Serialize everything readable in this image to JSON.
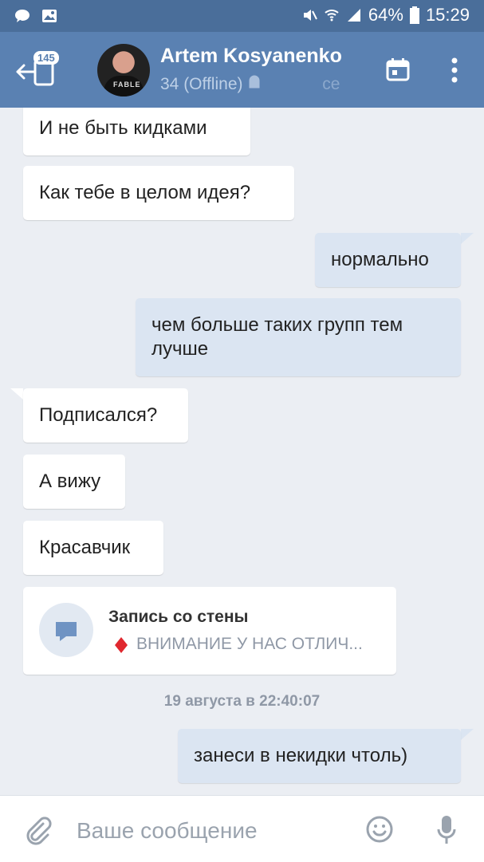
{
  "status_bar": {
    "battery": "64%",
    "time": "15:29"
  },
  "header": {
    "unread_badge": "145",
    "contact_name": "Artem Kosyanenko",
    "status": "34 (Offline)",
    "status_suffix": "се",
    "avatar_shirt_text": "FABLE"
  },
  "messages": [
    {
      "text": "И не быть кидками"
    },
    {
      "text": "Как тебе в целом идея?"
    },
    {
      "text": "нормально"
    },
    {
      "text_line1": "чем больше таких групп тем",
      "text_line2": "лучше"
    },
    {
      "text": "Подписался?"
    },
    {
      "text": "А вижу"
    },
    {
      "text": "Красавчик"
    },
    {
      "text": "занеси в некидки чтоль)"
    }
  ],
  "wall_post": {
    "title": "Запись со стены",
    "preview": "ВНИМАНИЕ У НАС ОТЛИЧ..."
  },
  "date_separator": "19 августа в 22:40:07",
  "composer": {
    "placeholder": "Ваше сообщение"
  },
  "colors": {
    "header": "#5a81b2",
    "status_bar": "#4a6e9a",
    "background": "#ebeef3",
    "outgoing_bubble": "#dbe5f2",
    "incoming_bubble": "#ffffff"
  }
}
